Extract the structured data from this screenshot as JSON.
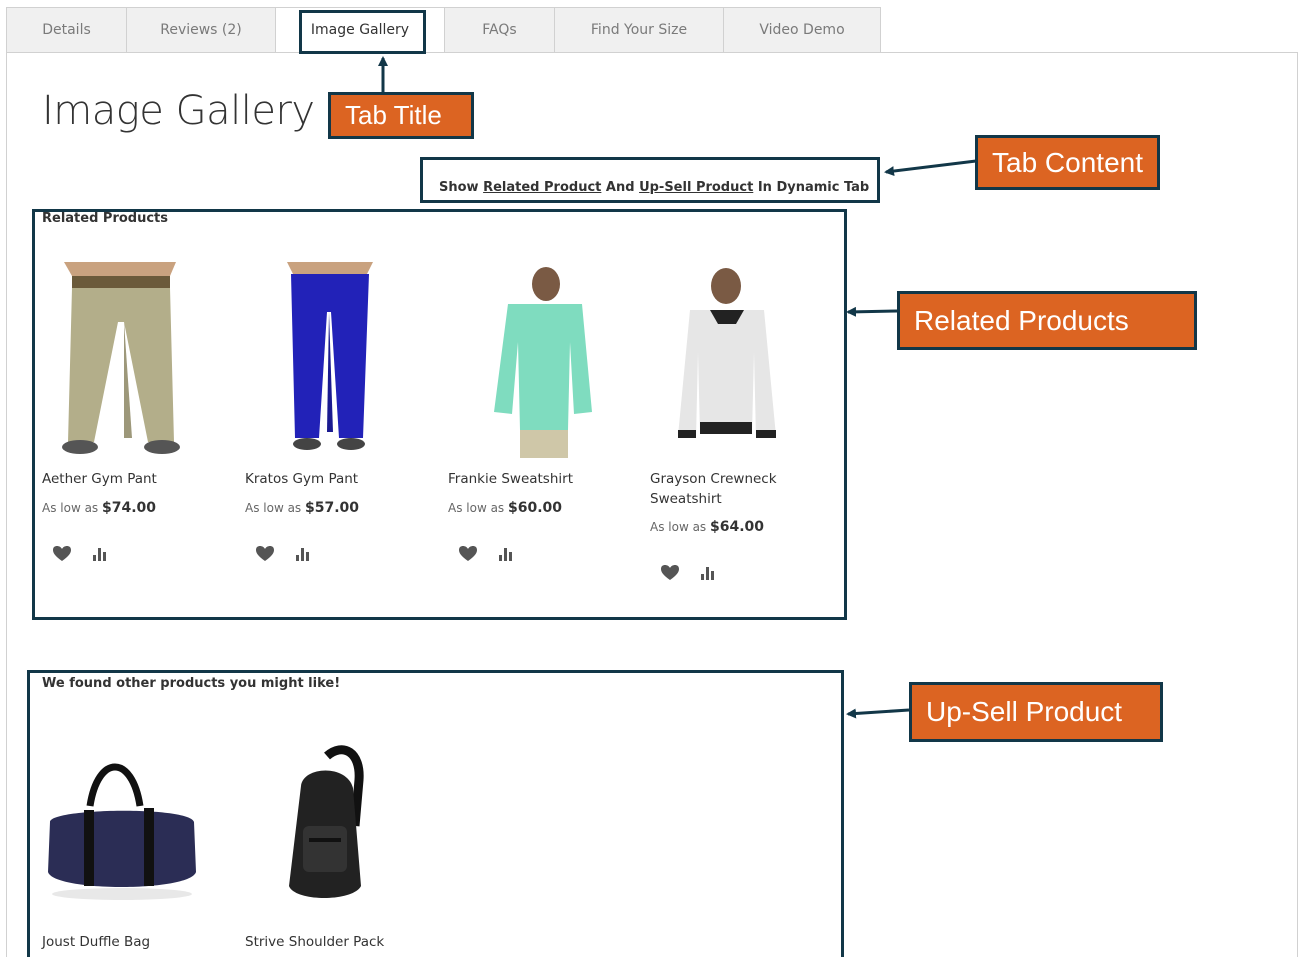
{
  "tabs": [
    {
      "label": "Details"
    },
    {
      "label": "Reviews (2)"
    },
    {
      "label": "Image Gallery",
      "active": true
    },
    {
      "label": "FAQs"
    },
    {
      "label": "Find Your Size"
    },
    {
      "label": "Video Demo"
    }
  ],
  "page_title": "Image Gallery",
  "intro": {
    "show": "Show",
    "related_link": "Related Product",
    "and": "And",
    "upsell_link": "Up-Sell Product",
    "suffix": "In Dynamic Tab"
  },
  "callouts": {
    "tab_title": "Tab Title",
    "tab_content": "Tab Content",
    "related_products": "Related Products",
    "upsell_product": "Up-Sell Product"
  },
  "related": {
    "title": "Related Products",
    "items": [
      {
        "name": "Aether Gym Pant",
        "price_prefix": "As low as",
        "price": "$74.00"
      },
      {
        "name": "Kratos Gym Pant",
        "price_prefix": "As low as",
        "price": "$57.00"
      },
      {
        "name": "Frankie Sweatshirt",
        "price_prefix": "As low as",
        "price": "$60.00"
      },
      {
        "name": "Grayson Crewneck Sweatshirt",
        "price_prefix": "As low as",
        "price": "$64.00"
      }
    ]
  },
  "upsell": {
    "title": "We found other products you might like!",
    "items": [
      {
        "name": "Joust Duffle Bag"
      },
      {
        "name": "Strive Shoulder Pack"
      }
    ]
  },
  "icons": {
    "wishlist": "heart-icon",
    "compare": "compare-icon"
  },
  "colors": {
    "callout": "#dc6422",
    "outline": "#123748"
  }
}
